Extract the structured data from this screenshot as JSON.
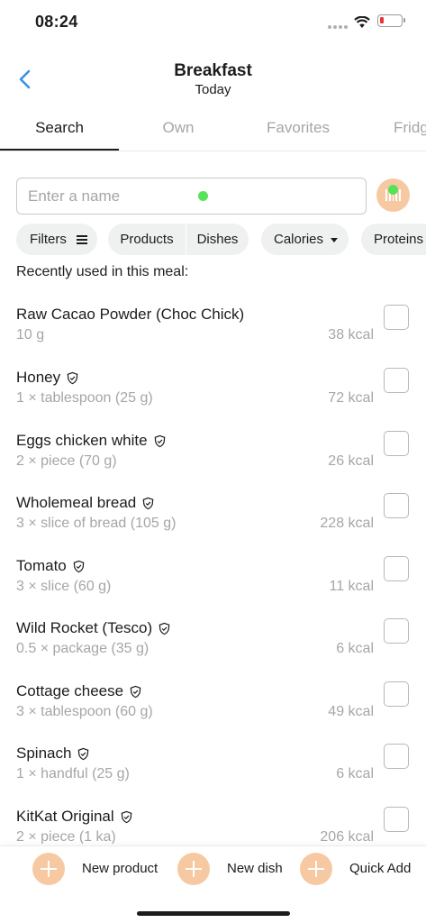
{
  "status_bar": {
    "time": "08:24",
    "wifi_icon": "wifi-icon",
    "battery_icon": "battery-low-icon",
    "battery_color": "#e53935"
  },
  "header": {
    "back_icon": "chevron-left-icon",
    "title": "Breakfast",
    "subtitle": "Today"
  },
  "tabs": [
    {
      "label": "Search",
      "active": true
    },
    {
      "label": "Own",
      "active": false
    },
    {
      "label": "Favorites",
      "active": false
    },
    {
      "label": "Fridge",
      "active": false
    }
  ],
  "search": {
    "placeholder": "Enter a name",
    "value": "",
    "barcode_icon": "barcode-icon",
    "accent_color": "#f7c9a2"
  },
  "chips": {
    "filters": "Filters",
    "products": "Products",
    "dishes": "Dishes",
    "calories": "Calories",
    "proteins": "Proteins"
  },
  "section_title": "Recently used in this meal:",
  "items": [
    {
      "name": "Raw Cacao Powder (Choc Chick)",
      "verified": false,
      "portion": "10 g",
      "kcal": "38 kcal",
      "checked": false
    },
    {
      "name": "Honey",
      "verified": true,
      "portion": "1 × tablespoon (25 g)",
      "kcal": "72 kcal",
      "checked": false
    },
    {
      "name": "Eggs chicken white",
      "verified": true,
      "portion": "2 × piece (70 g)",
      "kcal": "26 kcal",
      "checked": false
    },
    {
      "name": "Wholemeal bread",
      "verified": true,
      "portion": "3 × slice of bread (105 g)",
      "kcal": "228 kcal",
      "checked": false
    },
    {
      "name": "Tomato",
      "verified": true,
      "portion": "3 × slice (60 g)",
      "kcal": "11 kcal",
      "checked": false
    },
    {
      "name": "Wild Rocket (Tesco)",
      "verified": true,
      "portion": "0.5 × package (35 g)",
      "kcal": "6 kcal",
      "checked": false
    },
    {
      "name": "Cottage cheese",
      "verified": true,
      "portion": "3 × tablespoon (60 g)",
      "kcal": "49 kcal",
      "checked": false
    },
    {
      "name": "Spinach",
      "verified": true,
      "portion": "1 × handful (25 g)",
      "kcal": "6 kcal",
      "checked": false
    },
    {
      "name": "KitKat Original",
      "verified": true,
      "portion": "2 × piece (1 ka)",
      "kcal": "206 kcal",
      "checked": false
    }
  ],
  "bottom_actions": [
    {
      "label": "New product",
      "icon": "plus-icon"
    },
    {
      "label": "New dish",
      "icon": "plus-icon"
    },
    {
      "label": "Quick Add",
      "icon": "plus-icon"
    }
  ]
}
